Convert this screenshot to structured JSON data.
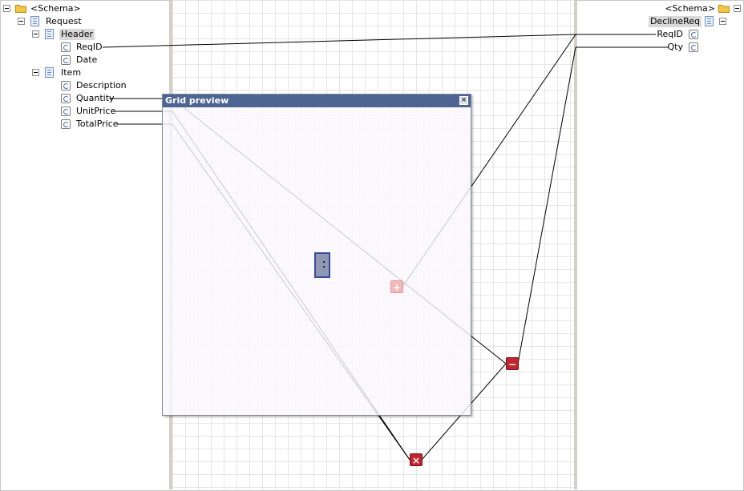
{
  "source_tree": {
    "root": "<Schema>",
    "nodes": [
      {
        "label": "Request"
      },
      {
        "label": "Header"
      },
      {
        "label": "ReqID"
      },
      {
        "label": "Date"
      },
      {
        "label": "Item"
      },
      {
        "label": "Description"
      },
      {
        "label": "Quantity"
      },
      {
        "label": "UnitPrice"
      },
      {
        "label": "TotalPrice"
      }
    ]
  },
  "destination_tree": {
    "root": "<Schema>",
    "nodes": [
      {
        "label": "DeclineReq"
      },
      {
        "label": "ReqID"
      },
      {
        "label": "Qty"
      }
    ]
  },
  "grid_preview": {
    "title": "Grid preview",
    "close_glyph": "×"
  },
  "functoids": {
    "multiply": {
      "glyph": "×"
    },
    "subtract": {
      "glyph": "−"
    },
    "add": {
      "glyph": "+"
    }
  },
  "colors": {
    "preview_title_bar": "#4d6592",
    "functoid_red": "#c0262d",
    "link_line": "#000000",
    "grid_line": "#e6e6e6",
    "splitter": "#d4d0c8"
  },
  "icons": {
    "expander": "collapse-minus-icon",
    "schema": "folder-icon",
    "record": "record-doc-icon",
    "field": "field-element-icon"
  }
}
